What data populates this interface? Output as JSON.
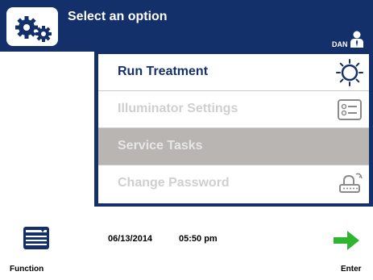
{
  "header": {
    "title": "Select an option",
    "user": "DAN",
    "icon": "gears-icon"
  },
  "menu": {
    "items": [
      {
        "label": "Run Treatment",
        "icon": "sun-icon",
        "state": "enabled"
      },
      {
        "label": "Illuminator Settings",
        "icon": "settings-list-icon",
        "state": "disabled"
      },
      {
        "label": "Service Tasks",
        "icon": "",
        "state": "selected"
      },
      {
        "label": "Change Password",
        "icon": "key-lock-icon",
        "state": "disabled"
      }
    ]
  },
  "footer": {
    "date": "06/13/2014",
    "time": "05:50 pm",
    "function_label": "Function",
    "enter_label": "Enter"
  },
  "colors": {
    "brand_blue": "#14306b",
    "enter_green": "#2fb52f",
    "selected_row": "#b9b5b2",
    "disabled_text": "#cfcfcf"
  }
}
